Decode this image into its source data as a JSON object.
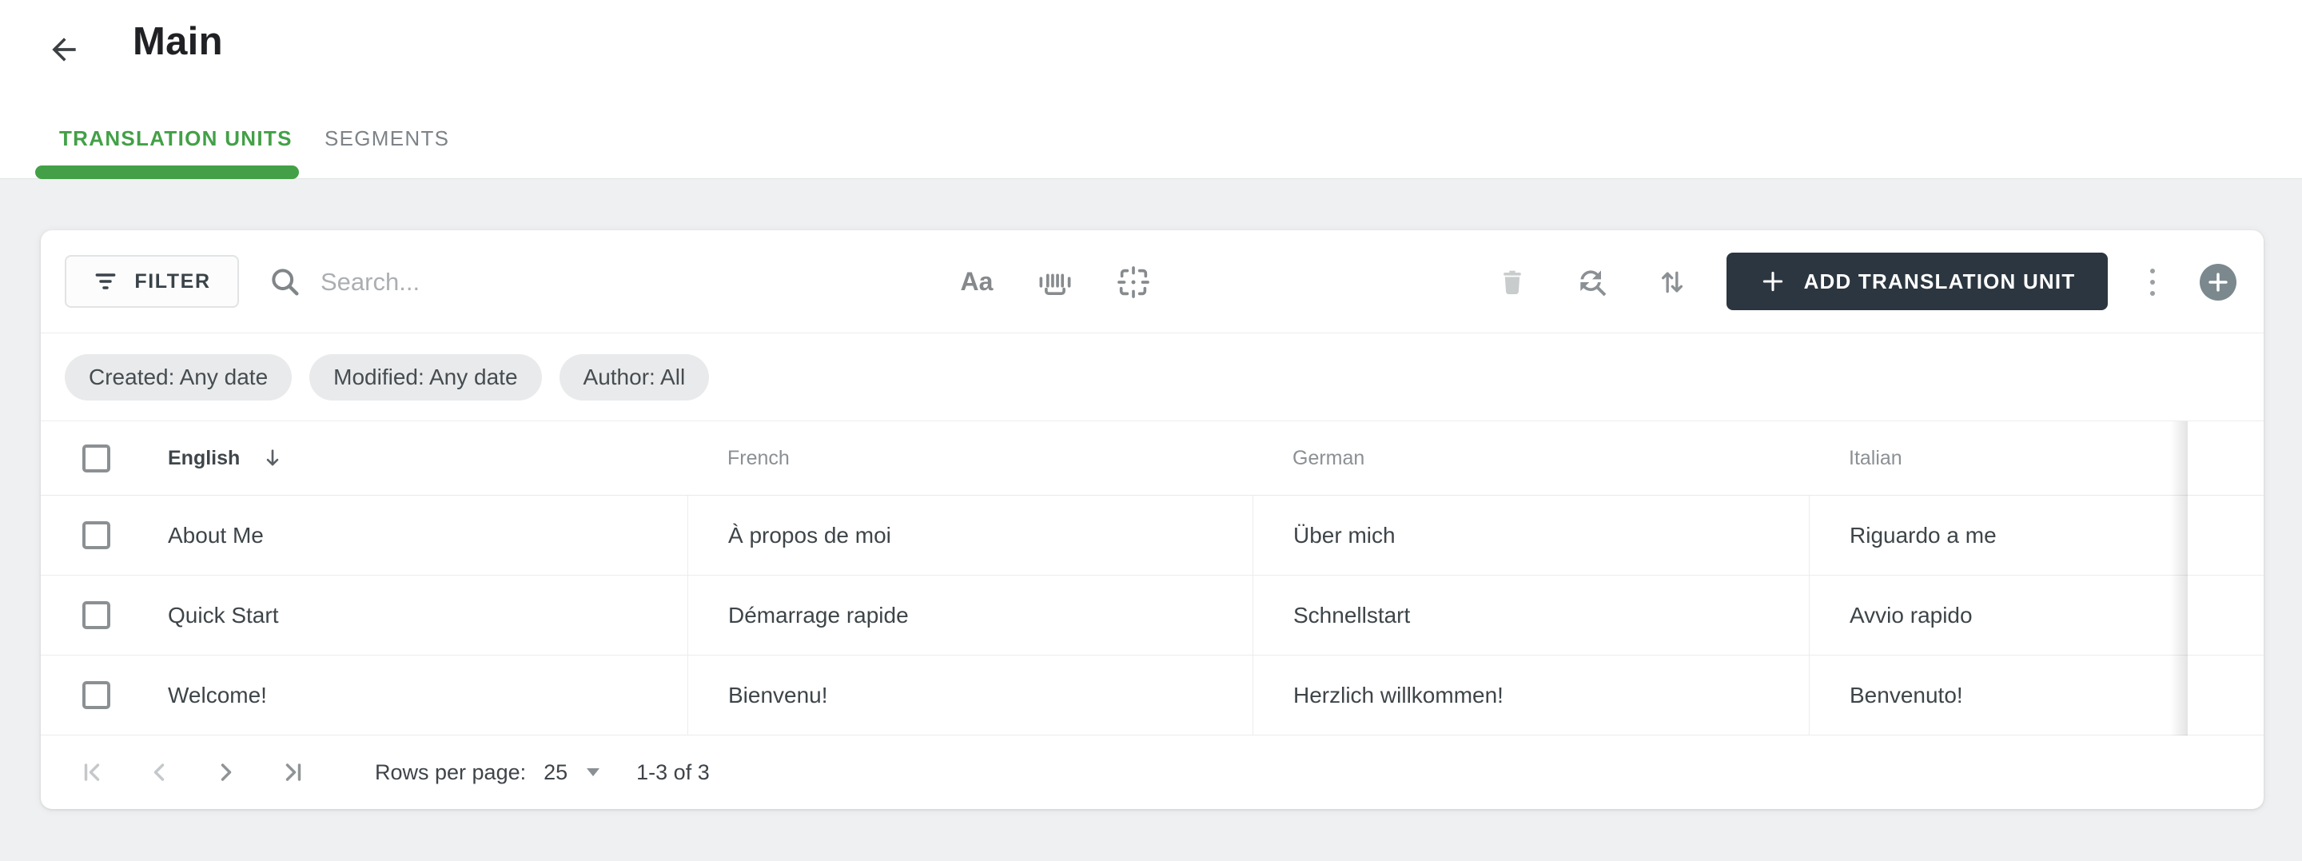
{
  "page": {
    "title": "Main",
    "back_icon": "arrow-left"
  },
  "tabs": {
    "items": [
      {
        "label": "TRANSLATION UNITS",
        "active": true
      },
      {
        "label": "SEGMENTS",
        "active": false
      }
    ]
  },
  "toolbar": {
    "filter_button": {
      "label": "FILTER",
      "icon": "filter-list"
    },
    "search": {
      "placeholder": "Search...",
      "icon": "magnifier"
    },
    "search_options": [
      {
        "icon": "match-case",
        "glyph": "Aa"
      },
      {
        "icon": "whole-word"
      },
      {
        "icon": "selection-frame"
      }
    ],
    "actions": [
      {
        "icon": "trash",
        "disabled": true
      },
      {
        "icon": "find-replace",
        "disabled": false
      },
      {
        "icon": "sort-vertical",
        "disabled": false
      }
    ],
    "add_button": {
      "label": "ADD TRANSLATION UNIT",
      "icon": "plus"
    },
    "more_menu_icon": "kebab-vertical",
    "fab_icon": "plus"
  },
  "filter_chips": [
    {
      "label": "Created: Any date"
    },
    {
      "label": "Modified: Any date"
    },
    {
      "label": "Author: All"
    }
  ],
  "table": {
    "select_all_checked": false,
    "columns": [
      "English",
      "French",
      "German",
      "Italian"
    ],
    "sort": {
      "column": "English",
      "indicator": "down-arrow"
    },
    "rows": [
      {
        "checked": false,
        "english": "About Me",
        "french": "À propos de moi",
        "german": "Über mich",
        "italian": "Riguardo a me"
      },
      {
        "checked": false,
        "english": "Quick Start",
        "french": "Démarrage rapide",
        "german": "Schnellstart",
        "italian": "Avvio rapido"
      },
      {
        "checked": false,
        "english": "Welcome!",
        "french": "Bienvenu!",
        "german": "Herzlich willkommen!",
        "italian": "Benvenuto!"
      }
    ]
  },
  "pagination": {
    "first_icon": "page-first",
    "prev_icon": "chevron-left",
    "next_icon": "chevron-right",
    "last_icon": "page-last",
    "rows_per_page_label": "Rows per page:",
    "rows_per_page_value": "25",
    "range_label": "1-3 of 3"
  },
  "colors": {
    "accent_green": "#43a047",
    "dark_button": "#2c3640",
    "page_background": "#eff0f1"
  }
}
